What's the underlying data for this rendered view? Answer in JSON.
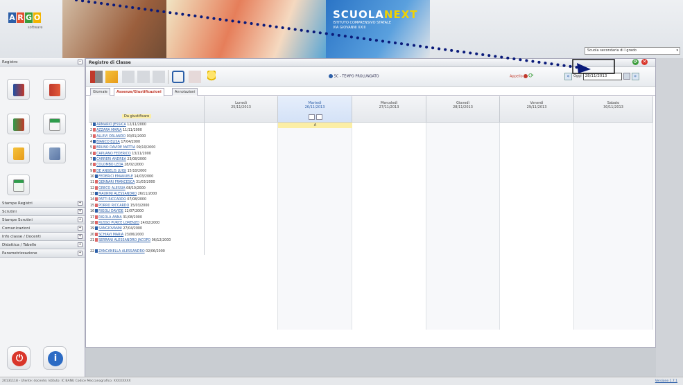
{
  "banner": {
    "logo_letters": [
      "A",
      "R",
      "G",
      "O"
    ],
    "logo_sub": "software",
    "brand_part1": "SCUOLA",
    "brand_part2": "NEXT",
    "school_line1": "ISTITUTO COMPRENSIVO STATALE",
    "school_line2": "VIA GIOVANNI XXIII",
    "school_select": "Scuola secondaria di I grado"
  },
  "sidebar": {
    "top_header": "Registro",
    "sections": [
      "Stampe Registri",
      "Scrutini",
      "Stampe Scrutini",
      "Comunicazioni",
      "Info classe / Docenti",
      "Didattica / Tabelle",
      "Parametrizzazione"
    ]
  },
  "main": {
    "title": "Registro di Classe",
    "class_label": "5C - TEMPO PROLUNGATO",
    "appello_label": "Appello",
    "oggi_label": "Oggi",
    "date_value": "28/11/2013",
    "tabs": [
      "Giornale",
      "Assenze/Giustificazioni",
      "Annotazioni"
    ],
    "students_header": "Da giustificare",
    "absence_mark": "A",
    "days": [
      {
        "name": "Lunedì",
        "date": "25/11/2013"
      },
      {
        "name": "Martedì",
        "date": "26/11/2013"
      },
      {
        "name": "Mercoledì",
        "date": "27/11/2013"
      },
      {
        "name": "Giovedì",
        "date": "28/11/2013"
      },
      {
        "name": "Venerdì",
        "date": "29/11/2013"
      },
      {
        "name": "Sabato",
        "date": "30/11/2013"
      }
    ],
    "students": [
      {
        "num": "1",
        "name": "ARMARIO JESSICA",
        "date": "12/11/2000"
      },
      {
        "num": "2",
        "name": "AZZARA MARIA",
        "date": "11/11/2000"
      },
      {
        "num": "3",
        "name": "ALLEVI ORLANDO",
        "date": "03/01/2000"
      },
      {
        "num": "4",
        "name": "BIANCO ELISA",
        "date": "17/04/2000"
      },
      {
        "num": "5",
        "name": "BRUNO DAVIDE MATTIA",
        "date": "09/10/2000"
      },
      {
        "num": "6",
        "name": "CAPUANO FEDERICO",
        "date": "13/11/2000"
      },
      {
        "num": "7",
        "name": "CARRERI ANDREA",
        "date": "23/08/2000"
      },
      {
        "num": "8",
        "name": "COLOMBO LEDA",
        "date": "28/02/2000"
      },
      {
        "num": "9",
        "name": "DE ANGELIS LUIGI",
        "date": "15/10/2000"
      },
      {
        "num": "10",
        "name": "FEDERICI EMANUELE",
        "date": "14/03/2000"
      },
      {
        "num": "11",
        "name": "GENNARI FRANCESCA",
        "date": "31/03/2000"
      },
      {
        "num": "12",
        "name": "GRECO ALESSIA",
        "date": "08/10/2000"
      },
      {
        "num": "13",
        "name": "MAURINI ALESSANDRO",
        "date": "26/11/2000"
      },
      {
        "num": "14",
        "name": "PATTI RICCARDO",
        "date": "07/08/2000"
      },
      {
        "num": "15",
        "name": "PORRO RICCARDO",
        "date": "15/03/2000"
      },
      {
        "num": "16",
        "name": "RIGOLI DAVIDE",
        "date": "12/07/2000"
      },
      {
        "num": "17",
        "name": "RIGOLA ANNA",
        "date": "31/08/2000"
      },
      {
        "num": "18",
        "name": "RUSSO PURCE LORENZO",
        "date": "24/02/2000"
      },
      {
        "num": "19",
        "name": "SANGIOVANNI",
        "date": "27/04/2000"
      },
      {
        "num": "20",
        "name": "SCHIAVI MARIA",
        "date": "23/06/2000"
      },
      {
        "num": "21",
        "name": "SERRANI ALESSANDRO JACOPO",
        "date": "06/12/2000"
      },
      {
        "num": "22",
        "name": "ZANCANELLA ALESSANDRO",
        "date": "02/06/2000"
      }
    ]
  },
  "status": {
    "left": "20131118 - Utente: docente; Istituto: IC BANU Codice Meccanografico: XXXXXXXX",
    "version": "Versione 1.7.1"
  },
  "colors": {
    "accent": "#2c5fa8",
    "highlight": "#fbeea5",
    "alert": "#c0392b"
  }
}
